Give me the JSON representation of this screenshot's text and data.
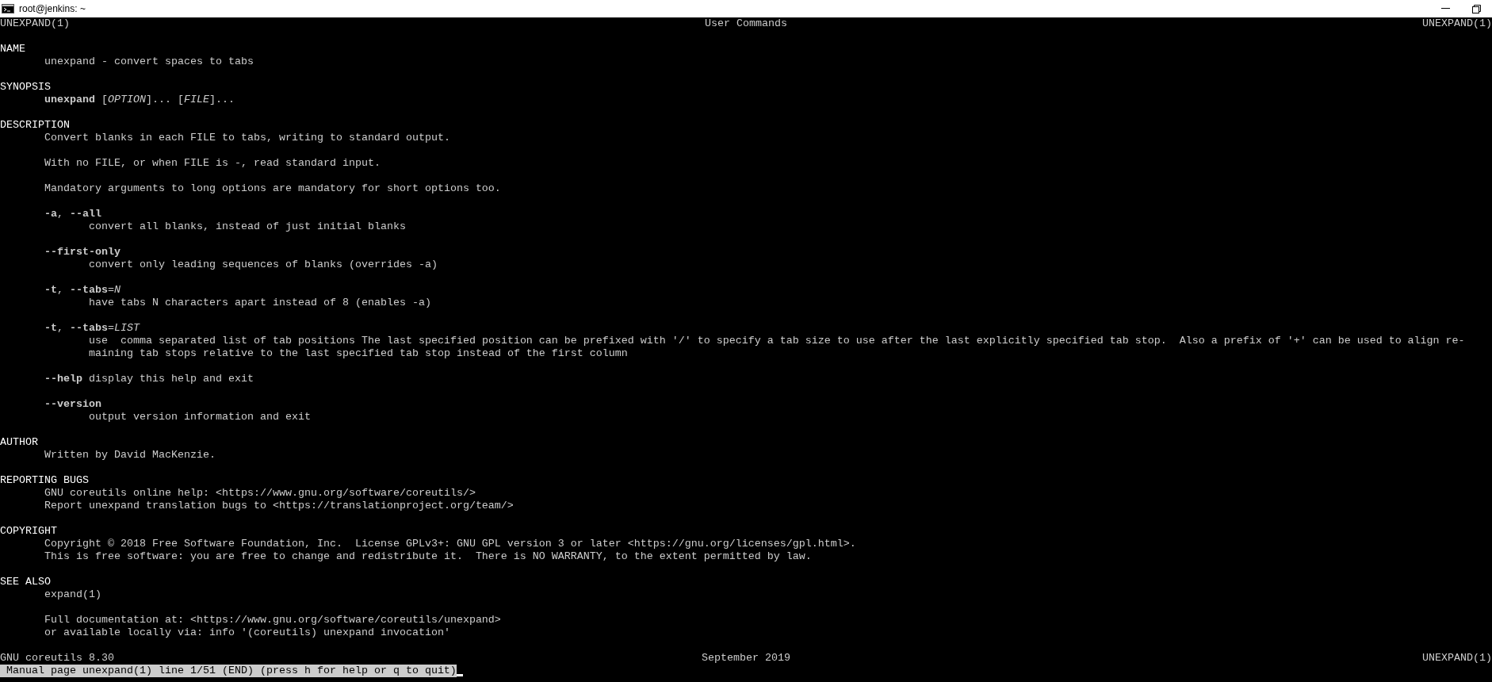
{
  "window": {
    "title": "root@jenkins: ~"
  },
  "header": {
    "left": "UNEXPAND(1)",
    "center": "User Commands",
    "right": "UNEXPAND(1)"
  },
  "sections": [
    {
      "heading": "NAME",
      "blocks": [
        {
          "kind": "para",
          "lines": [
            "unexpand - convert spaces to tabs"
          ]
        }
      ]
    },
    {
      "heading": "SYNOPSIS",
      "blocks": [
        {
          "kind": "para",
          "lines": [
            "**unexpand** [*OPTION*]... [*FILE*]..."
          ]
        }
      ]
    },
    {
      "heading": "DESCRIPTION",
      "blocks": [
        {
          "kind": "para",
          "lines": [
            "Convert blanks in each FILE to tabs, writing to standard output."
          ]
        },
        {
          "kind": "para",
          "lines": [
            "With no FILE, or when FILE is -, read standard input."
          ]
        },
        {
          "kind": "para",
          "lines": [
            "Mandatory arguments to long options are mandatory for short options too."
          ]
        },
        {
          "kind": "option",
          "term": "**-a**, **--all**",
          "lines": [
            "convert all blanks, instead of just initial blanks"
          ]
        },
        {
          "kind": "option",
          "term": "**--first-only**",
          "lines": [
            "convert only leading sequences of blanks (overrides -a)"
          ]
        },
        {
          "kind": "option",
          "term": "**-t**, **--tabs**=*N*",
          "lines": [
            "have tabs N characters apart instead of 8 (enables -a)"
          ]
        },
        {
          "kind": "option",
          "term": "**-t**, **--tabs**=*LIST*",
          "lines": [
            "use  comma separated list of tab positions The last specified position can be prefixed with '/' to specify a tab size to use after the last explicitly specified tab stop.  Also a prefix of '+' can be used to align re-",
            "maining tab stops relative to the last specified tab stop instead of the first column"
          ]
        },
        {
          "kind": "para",
          "lines": [
            "**--help** display this help and exit"
          ]
        },
        {
          "kind": "option",
          "term": "**--version**",
          "lines": [
            "output version information and exit"
          ]
        }
      ]
    },
    {
      "heading": "AUTHOR",
      "blocks": [
        {
          "kind": "para",
          "lines": [
            "Written by David MacKenzie."
          ]
        }
      ]
    },
    {
      "heading": "REPORTING BUGS",
      "blocks": [
        {
          "kind": "para",
          "lines": [
            "GNU coreutils online help: <https://www.gnu.org/software/coreutils/>",
            "Report unexpand translation bugs to <https://translationproject.org/team/>"
          ]
        }
      ]
    },
    {
      "heading": "COPYRIGHT",
      "blocks": [
        {
          "kind": "para",
          "lines": [
            "Copyright © 2018 Free Software Foundation, Inc.  License GPLv3+: GNU GPL version 3 or later <https://gnu.org/licenses/gpl.html>.",
            "This is free software: you are free to change and redistribute it.  There is NO WARRANTY, to the extent permitted by law."
          ]
        }
      ]
    },
    {
      "heading": "SEE ALSO",
      "blocks": [
        {
          "kind": "para",
          "lines": [
            "expand(1)"
          ]
        },
        {
          "kind": "para",
          "lines": [
            "Full documentation at: <https://www.gnu.org/software/coreutils/unexpand>",
            "or available locally via: info '(coreutils) unexpand invocation'"
          ]
        }
      ]
    }
  ],
  "footer": {
    "left": "GNU coreutils 8.30",
    "center": "September 2019",
    "right": "UNEXPAND(1)"
  },
  "status": "Manual page unexpand(1) line 1/51 (END) (press h for help or q to quit)"
}
